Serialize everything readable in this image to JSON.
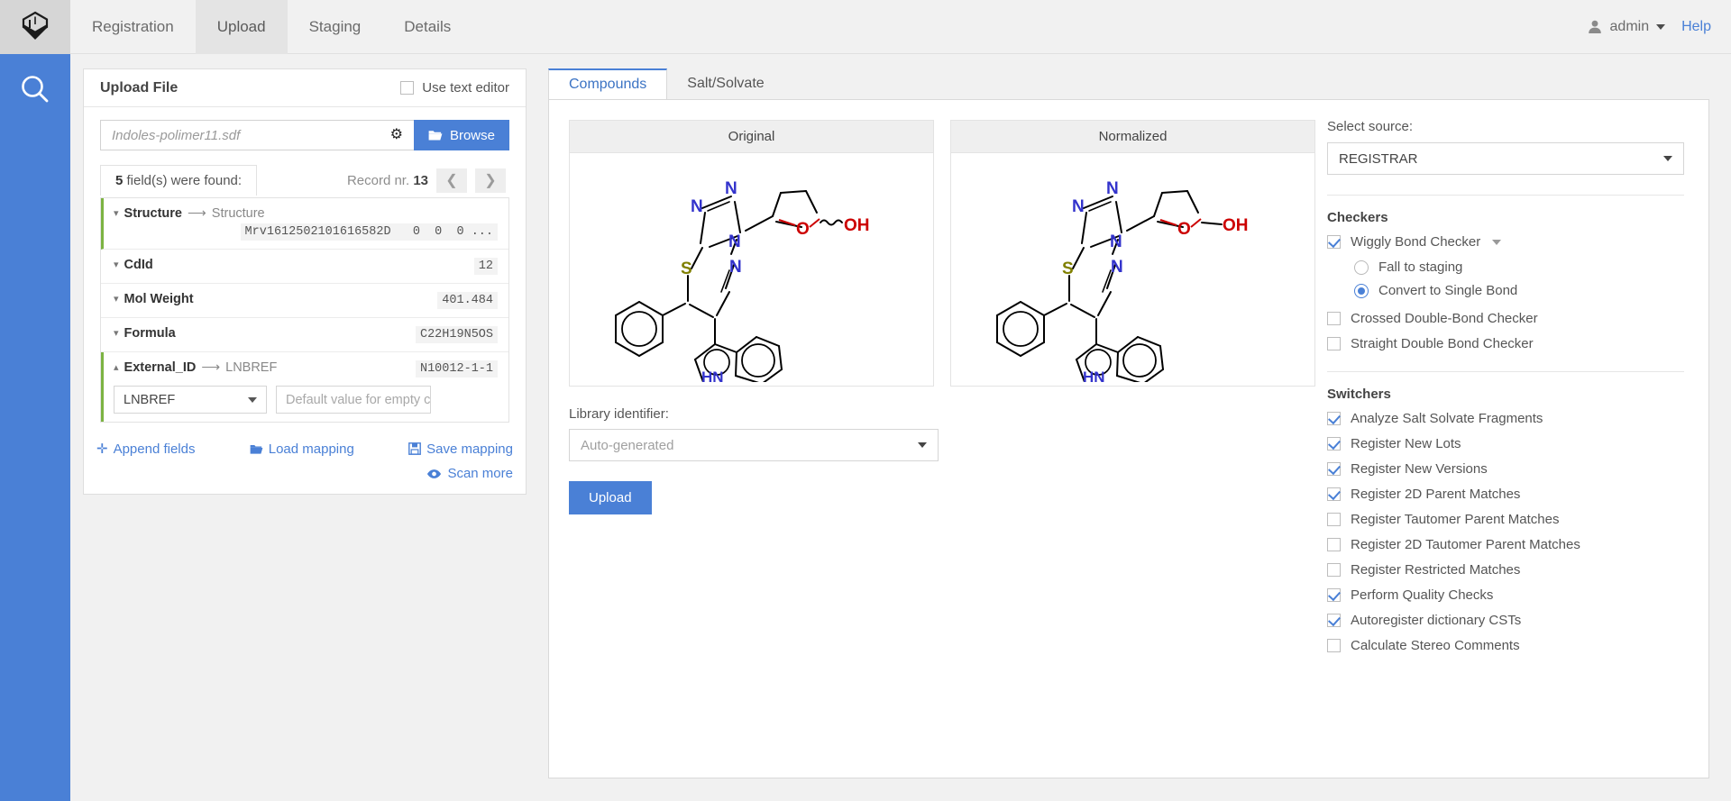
{
  "rail": {
    "logo_icon": "cube-logo-icon",
    "search_icon": "search-icon"
  },
  "topnav": {
    "items": [
      {
        "label": "Registration",
        "active": false
      },
      {
        "label": "Upload",
        "active": true
      },
      {
        "label": "Staging",
        "active": false
      },
      {
        "label": "Details",
        "active": false
      }
    ],
    "user": "admin",
    "help": "Help"
  },
  "upload_card": {
    "title": "Upload File",
    "use_text_editor": {
      "label": "Use text editor",
      "checked": false
    },
    "file_name": "Indoles-polimer11.sdf",
    "browse_label": "Browse",
    "fields_found_count": "5",
    "fields_found_text": " field(s) were found:",
    "record_label": "Record nr.",
    "record_number": "13",
    "prev_icon": "chevron-left-icon",
    "next_icon": "chevron-right-icon",
    "fields": [
      {
        "key": "Structure",
        "target": "Structure",
        "value": "Mrv1612502101616582D   0  0  0 ...",
        "value_second_line": true,
        "accent": true,
        "expanded": false
      },
      {
        "key": "CdId",
        "target": "",
        "value": "12",
        "value_second_line": false,
        "accent": false,
        "expanded": false
      },
      {
        "key": "Mol Weight",
        "target": "",
        "value": "401.484",
        "value_second_line": false,
        "accent": false,
        "expanded": false
      },
      {
        "key": "Formula",
        "target": "",
        "value": "C22H19N5OS",
        "value_second_line": false,
        "accent": false,
        "expanded": false
      },
      {
        "key": "External_ID",
        "target": "LNBREF",
        "value": "N10012-1-1",
        "value_second_line": false,
        "accent": true,
        "expanded": true,
        "select_value": "LNBREF",
        "default_placeholder": "Default value for empty cases"
      }
    ],
    "links": {
      "append_fields": "Append fields",
      "load_mapping": "Load mapping",
      "save_mapping": "Save mapping",
      "scan_more": "Scan more"
    }
  },
  "main": {
    "tabs": [
      {
        "label": "Compounds",
        "active": true
      },
      {
        "label": "Salt/Solvate",
        "active": false
      }
    ],
    "original_title": "Original",
    "normalized_title": "Normalized",
    "library_identifier_label": "Library identifier:",
    "library_identifier_value": "Auto-generated",
    "upload_button": "Upload"
  },
  "options": {
    "select_source_label": "Select source:",
    "select_source_value": "REGISTRAR",
    "checkers_title": "Checkers",
    "checkers": [
      {
        "label": "Wiggly Bond Checker",
        "checked": true,
        "has_dropdown": true
      },
      {
        "label": "Crossed Double-Bond Checker",
        "checked": false,
        "has_dropdown": false
      },
      {
        "label": "Straight Double Bond Checker",
        "checked": false,
        "has_dropdown": false
      }
    ],
    "wiggly_radios": [
      {
        "label": "Fall to staging",
        "selected": false
      },
      {
        "label": "Convert to Single Bond",
        "selected": true
      }
    ],
    "switchers_title": "Switchers",
    "switchers": [
      {
        "label": "Analyze Salt Solvate Fragments",
        "checked": true
      },
      {
        "label": "Register New Lots",
        "checked": true
      },
      {
        "label": "Register New Versions",
        "checked": true
      },
      {
        "label": "Register 2D Parent Matches",
        "checked": true
      },
      {
        "label": "Register Tautomer Parent Matches",
        "checked": false
      },
      {
        "label": "Register 2D Tautomer Parent Matches",
        "checked": false
      },
      {
        "label": "Register Restricted Matches",
        "checked": false
      },
      {
        "label": "Perform Quality Checks",
        "checked": true
      },
      {
        "label": "Autoregister dictionary CSTs",
        "checked": true
      },
      {
        "label": "Calculate Stereo Comments",
        "checked": false
      }
    ]
  },
  "colors": {
    "accent_blue": "#4a80d6",
    "rail_blue": "#4a80d6",
    "accent_green": "#7cb342",
    "nitrogen_blue": "#3333cc",
    "oxygen_red": "#cc0000",
    "sulfur_yellow": "#808000"
  }
}
